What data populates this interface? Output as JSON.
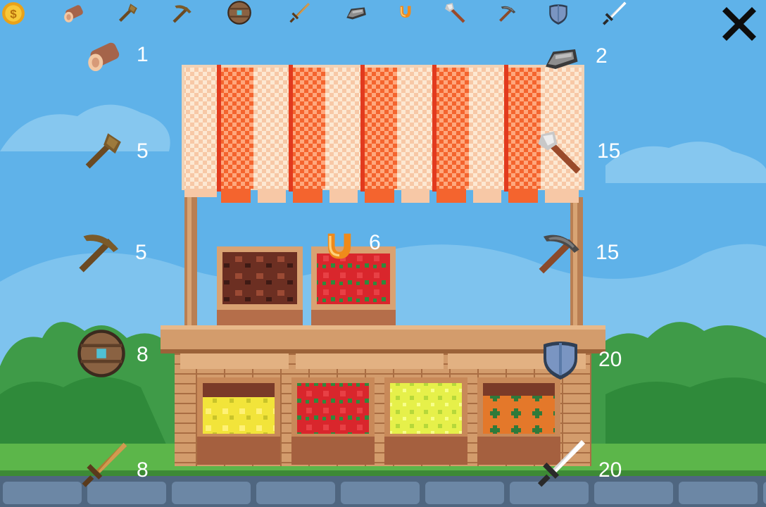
{
  "colors": {
    "sky": "#5fb2e9",
    "awning_red": "#f0502a",
    "awning_cream": "#fde6cf",
    "wood": "#c98f5e",
    "wood_dark": "#7a4a2e",
    "grass": "#49a04a",
    "price_text": "#ffffff"
  },
  "inventory_bar": {
    "items": [
      {
        "icon": "coin-icon"
      },
      {
        "icon": "log-icon"
      },
      {
        "icon": "wooden-axe-icon"
      },
      {
        "icon": "wooden-pickaxe-icon"
      },
      {
        "icon": "round-shield-icon"
      },
      {
        "icon": "wooden-sword-icon"
      },
      {
        "icon": "iron-ingot-icon"
      },
      {
        "icon": "horseshoe-icon"
      },
      {
        "icon": "iron-axe-icon"
      },
      {
        "icon": "iron-pickaxe-icon"
      },
      {
        "icon": "iron-shield-icon"
      },
      {
        "icon": "iron-sword-icon"
      }
    ]
  },
  "close_button": {
    "icon": "close-icon"
  },
  "shop": {
    "items": [
      {
        "icon": "log-icon",
        "price": "1"
      },
      {
        "icon": "wooden-axe-icon",
        "price": "5"
      },
      {
        "icon": "wooden-pickaxe-icon",
        "price": "5"
      },
      {
        "icon": "round-shield-icon",
        "price": "8"
      },
      {
        "icon": "wooden-sword-icon",
        "price": "8"
      },
      {
        "icon": "horseshoe-icon",
        "price": "6"
      },
      {
        "icon": "iron-ingot-icon",
        "price": "2"
      },
      {
        "icon": "iron-axe-icon",
        "price": "15"
      },
      {
        "icon": "iron-pickaxe-icon",
        "price": "15"
      },
      {
        "icon": "iron-shield-icon",
        "price": "20"
      },
      {
        "icon": "iron-sword-icon",
        "price": "20"
      }
    ]
  }
}
